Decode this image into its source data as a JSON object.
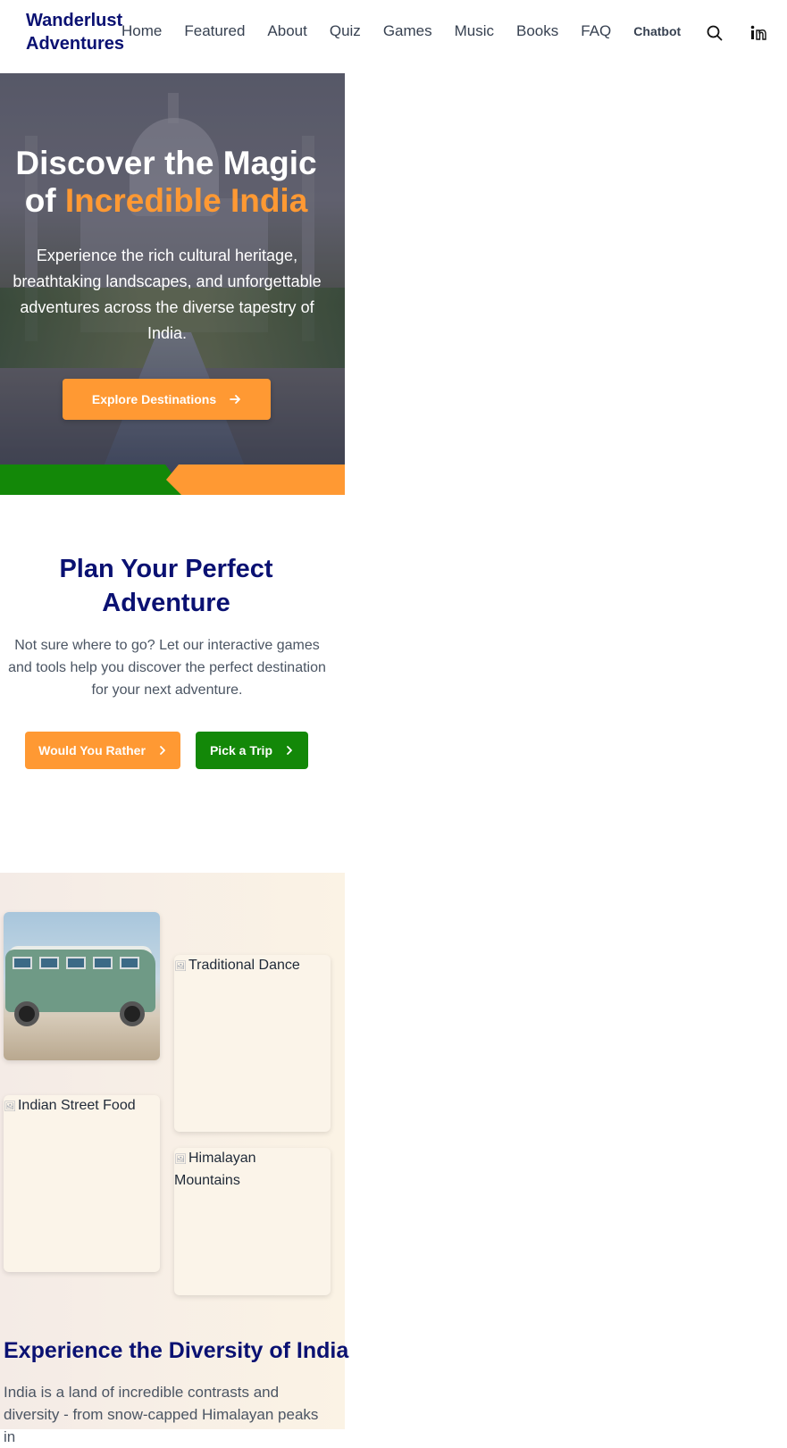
{
  "nav": {
    "brand_line1": "Wanderlust",
    "brand_line2": "Adventures",
    "links": [
      "Home",
      "Featured",
      "About",
      "Quiz",
      "Games",
      "Music",
      "Books",
      "FAQ",
      "Chatbot"
    ],
    "icons": [
      "search-icon",
      "linkedin-icon"
    ]
  },
  "hero": {
    "title_part1": "Discover the Magic of ",
    "title_accent": "Incredible India",
    "subtitle": "Experience the rich cultural heritage, breathtaking landscapes, and unforgettable adventures across the diverse tapestry of India.",
    "cta_label": "Explore Destinations"
  },
  "plan": {
    "title": "Plan Your Perfect Adventure",
    "text": "Not sure where to go? Let our interactive games and tools help you discover the perfect destination for your next adventure.",
    "btn_rather": "Would You Rather",
    "btn_pick": "Pick a Trip"
  },
  "diversity": {
    "img_dance": "Traditional Dance",
    "img_food": "Indian Street Food",
    "img_mountains": "Himalayan Mountains",
    "title": "Experience the Diversity of India",
    "text": "India is a land of incredible contrasts and diversity - from snow-capped Himalayan peaks in"
  },
  "colors": {
    "navy": "#0a1172",
    "saffron": "#ff9933",
    "green": "#138808"
  }
}
